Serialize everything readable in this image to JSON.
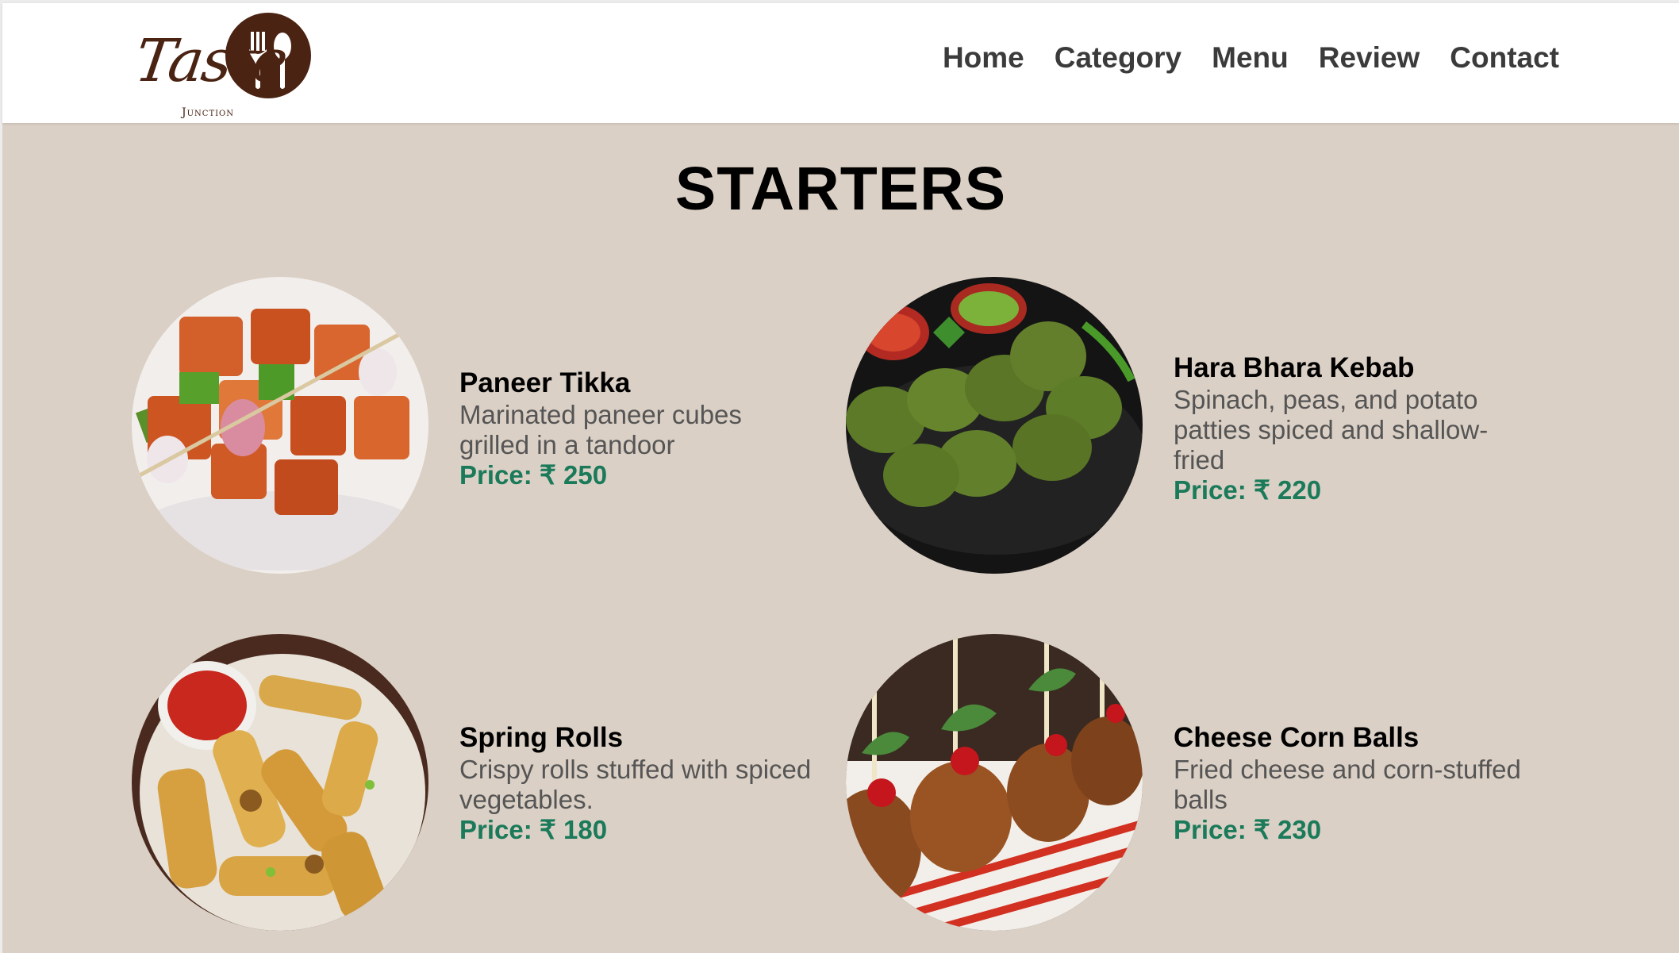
{
  "brand": {
    "logo_script": "Taste",
    "logo_sub": "Junction"
  },
  "nav": {
    "items": [
      {
        "label": "Home"
      },
      {
        "label": "Category"
      },
      {
        "label": "Menu"
      },
      {
        "label": "Review"
      },
      {
        "label": "Contact"
      }
    ]
  },
  "section": {
    "title": "STARTERS"
  },
  "menu": {
    "items": [
      {
        "name": "Paneer Tikka",
        "description": "Marinated paneer cubes grilled in a tandoor",
        "price": "Price: ₹ 250"
      },
      {
        "name": "Hara Bhara Kebab",
        "description": "Spinach, peas, and potato patties spiced and shallow-fried",
        "price": "Price: ₹ 220"
      },
      {
        "name": "Spring Rolls",
        "description": "Crispy rolls stuffed with spiced vegetables.",
        "price": "Price: ₹ 180"
      },
      {
        "name": "Cheese Corn Balls",
        "description": "Fried cheese and corn-stuffed balls",
        "price": "Price: ₹ 230"
      }
    ]
  },
  "colors": {
    "page_bg": "#dbd0c5",
    "header_bg": "#ffffff",
    "nav_text": "#3b3b3b",
    "price": "#1a7a5a",
    "logo_brown": "#4a2313"
  }
}
